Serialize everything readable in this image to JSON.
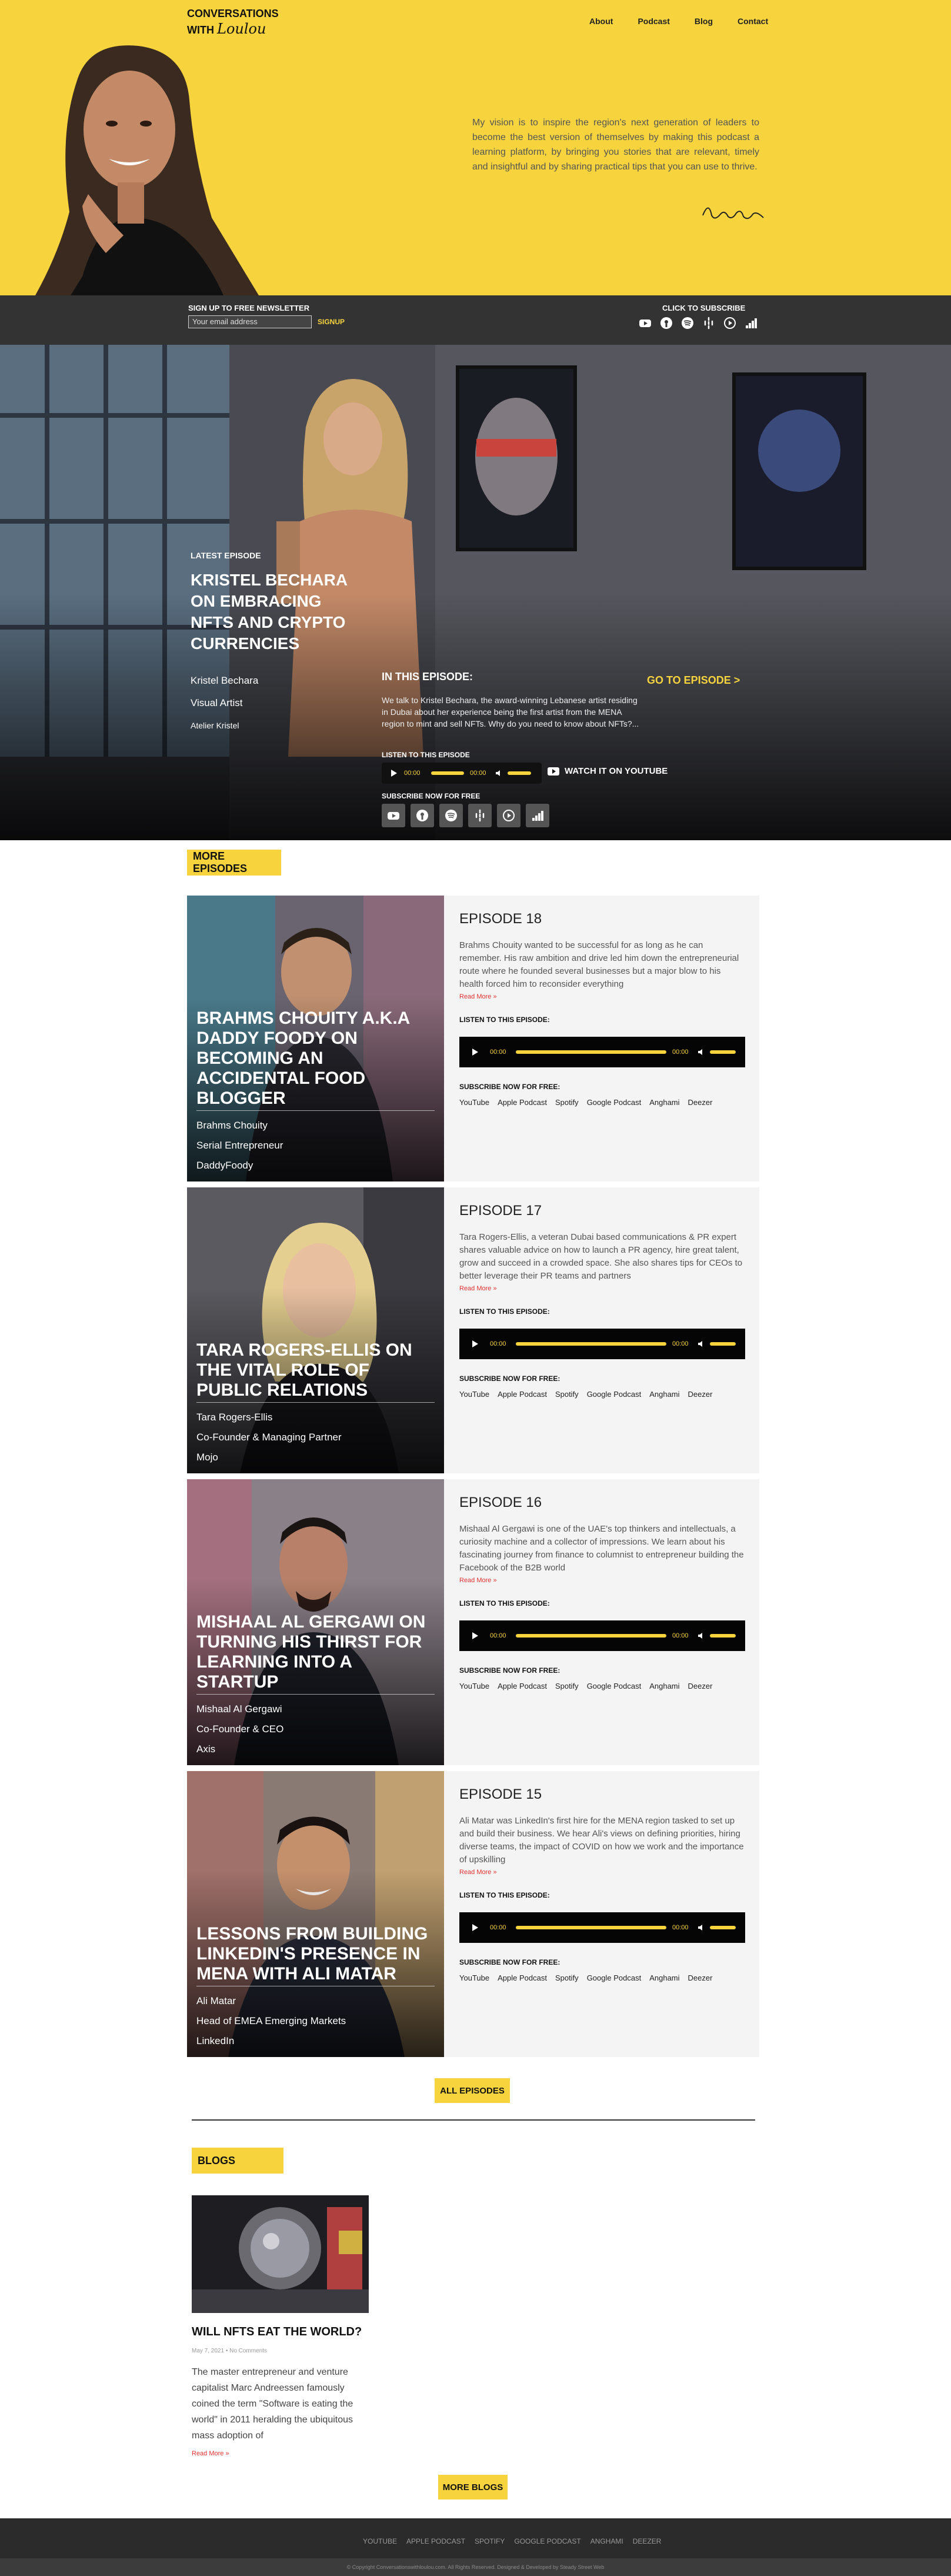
{
  "header": {
    "logo_line1": "CONVERSATIONS",
    "logo_line2": "WITH",
    "logo_signature": "Loulou",
    "nav": [
      "About",
      "Podcast",
      "Blog",
      "Contact"
    ],
    "vision": "My vision is to inspire the region's next generation of leaders to become the best version of themselves by making this podcast a learning platform, by bringing you stories that are relevant, timely and insightful and by sharing practical tips that you can use to thrive.",
    "signature": "Loulou"
  },
  "newsletter": {
    "title": "SIGN UP TO FREE NEWSLETTER",
    "placeholder": "Your email address",
    "signup": "SIGNUP",
    "subscribe_title": "CLICK TO SUBSCRIBE",
    "icons": [
      "youtube-icon",
      "apple-podcast-icon",
      "spotify-icon",
      "google-podcast-icon",
      "anghami-icon",
      "deezer-icon"
    ]
  },
  "featured": {
    "label": "LATEST EPISODE",
    "title": "KRISTEL BECHARA ON EMBRACING NFTS AND CRYPTO CURRENCIES",
    "guest": [
      "Kristel Bechara",
      "Visual Artist",
      "Atelier Kristel"
    ],
    "in_this_episode": "IN THIS EPISODE:",
    "description": "We talk to Kristel Bechara, the award-winning Lebanese artist residing in Dubai about her experience being the first artist from the MENA region to mint and sell NFTs. Why do you need to know about NFTs?...",
    "goto": "GO TO EPISODE >",
    "listen": "LISTEN TO THIS EPISODE",
    "time_start": "00:00",
    "time_end": "00:00",
    "watch": "WATCH IT ON YOUTUBE",
    "subscribe_free": "SUBSCRIBE NOW FOR FREE"
  },
  "more_episodes": {
    "heading": "MORE EPISODES",
    "listen_label": "LISTEN TO THIS EPISODE:",
    "subscribe_label": "SUBSCRIBE NOW FOR FREE:",
    "read_more": "Read More »",
    "platforms": [
      "YouTube",
      "Apple Podcast",
      "Spotify",
      "Google Podcast",
      "Anghami",
      "Deezer"
    ],
    "time": "00:00",
    "items": [
      {
        "number": "EPISODE 18",
        "title": "BRAHMS CHOUITY A.K.A DADDY FOODY ON BECOMING AN ACCIDENTAL FOOD BLOGGER",
        "meta": [
          "Brahms Chouity",
          "Serial Entrepreneur",
          "DaddyFoody"
        ],
        "description": "Brahms Chouity wanted to be successful for as long as he can remember. His raw ambition and drive led him down the entrepreneurial route where he founded several businesses but a major blow to his health forced him to reconsider everything"
      },
      {
        "number": "EPISODE 17",
        "title": "TARA ROGERS-ELLIS ON THE VITAL ROLE OF PUBLIC RELATIONS",
        "meta": [
          "Tara Rogers-Ellis",
          "Co-Founder & Managing Partner",
          "Mojo"
        ],
        "description": "Tara Rogers-Ellis, a veteran Dubai based communications & PR expert shares valuable advice on how to launch a PR agency, hire great talent, grow and succeed in a crowded space. She also shares tips for CEOs to better leverage their PR teams and partners"
      },
      {
        "number": "EPISODE 16",
        "title": "MISHAAL AL GERGAWI ON TURNING HIS THIRST FOR LEARNING INTO A STARTUP",
        "meta": [
          "Mishaal Al Gergawi",
          "Co-Founder & CEO",
          "Axis"
        ],
        "description": "Mishaal Al Gergawi is one of the UAE's top thinkers and intellectuals, a curiosity machine and a collector of impressions. We learn about his fascinating journey from finance to columnist to entrepreneur building the Facebook of the B2B world"
      },
      {
        "number": "EPISODE 15",
        "title": "LESSONS FROM BUILDING LINKEDIN'S PRESENCE IN MENA WITH ALI MATAR",
        "meta": [
          "Ali Matar",
          "Head of EMEA Emerging Markets",
          "LinkedIn"
        ],
        "description": "Ali Matar was LinkedIn's first hire for the MENA region tasked to set up and build their business. We hear Ali's views on defining priorities, hiring diverse teams, the impact of COVID on how we work and the importance of upskilling"
      }
    ],
    "all_button": "ALL EPISODES"
  },
  "blogs": {
    "heading": "BLOGS",
    "post_title": "WILL NFTS EAT THE WORLD?",
    "post_meta": "May 7, 2021 • No Comments",
    "post_excerpt": "The master entrepreneur and venture capitalist Marc Andreessen famously coined the term \"Software is eating the world\" in 2011 heralding the ubiquitous mass adoption of",
    "read_more": "Read More »",
    "more_button": "MORE BLOGS"
  },
  "footer": {
    "links": [
      "YOUTUBE",
      "APPLE PODCAST",
      "SPOTIFY",
      "GOOGLE PODCAST",
      "ANGHAMI",
      "DEEZER"
    ],
    "copyright": "© Copyright Conversationswithloulou.com. All Rights Reserved. Designed & Developed by Steady Street Web"
  },
  "colors": {
    "accent": "#f7d43d",
    "dark": "#333333",
    "panel": "#f4f4f4",
    "link_red": "#e03030"
  }
}
